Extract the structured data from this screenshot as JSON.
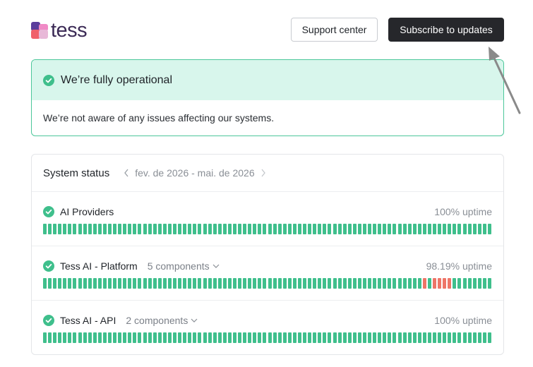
{
  "brand": {
    "name": "tess",
    "colors": {
      "pink": "#f08ac6",
      "red": "#f0606b",
      "purple": "#5b3d9c",
      "text": "#3c2b56"
    }
  },
  "header": {
    "support_label": "Support center",
    "subscribe_label": "Subscribe to updates"
  },
  "operational": {
    "title": "We’re fully operational",
    "message": "We’re not aware of any issues affecting our systems.",
    "accent": "#4cc79a"
  },
  "system_status": {
    "title": "System status",
    "range": "fev. de 2026 - mai. de 2026",
    "groups": [
      {
        "name": "AI Providers",
        "components": "",
        "uptime": "100% uptime",
        "bars": 90,
        "down_bars": []
      },
      {
        "name": "Tess AI - Platform",
        "components": "5 components",
        "uptime": "98.19% uptime",
        "bars": 90,
        "down_bars": [
          76,
          78,
          79,
          80,
          81
        ]
      },
      {
        "name": "Tess AI - API",
        "components": "2 components",
        "uptime": "100% uptime",
        "bars": 90,
        "down_bars": []
      }
    ],
    "colors": {
      "up": "#3fbf8c",
      "down": "#ee7567"
    }
  },
  "icons": {
    "status": "check-circle-icon",
    "prev": "chevron-left-icon",
    "next": "chevron-right-icon",
    "expand": "chevron-down-icon"
  }
}
